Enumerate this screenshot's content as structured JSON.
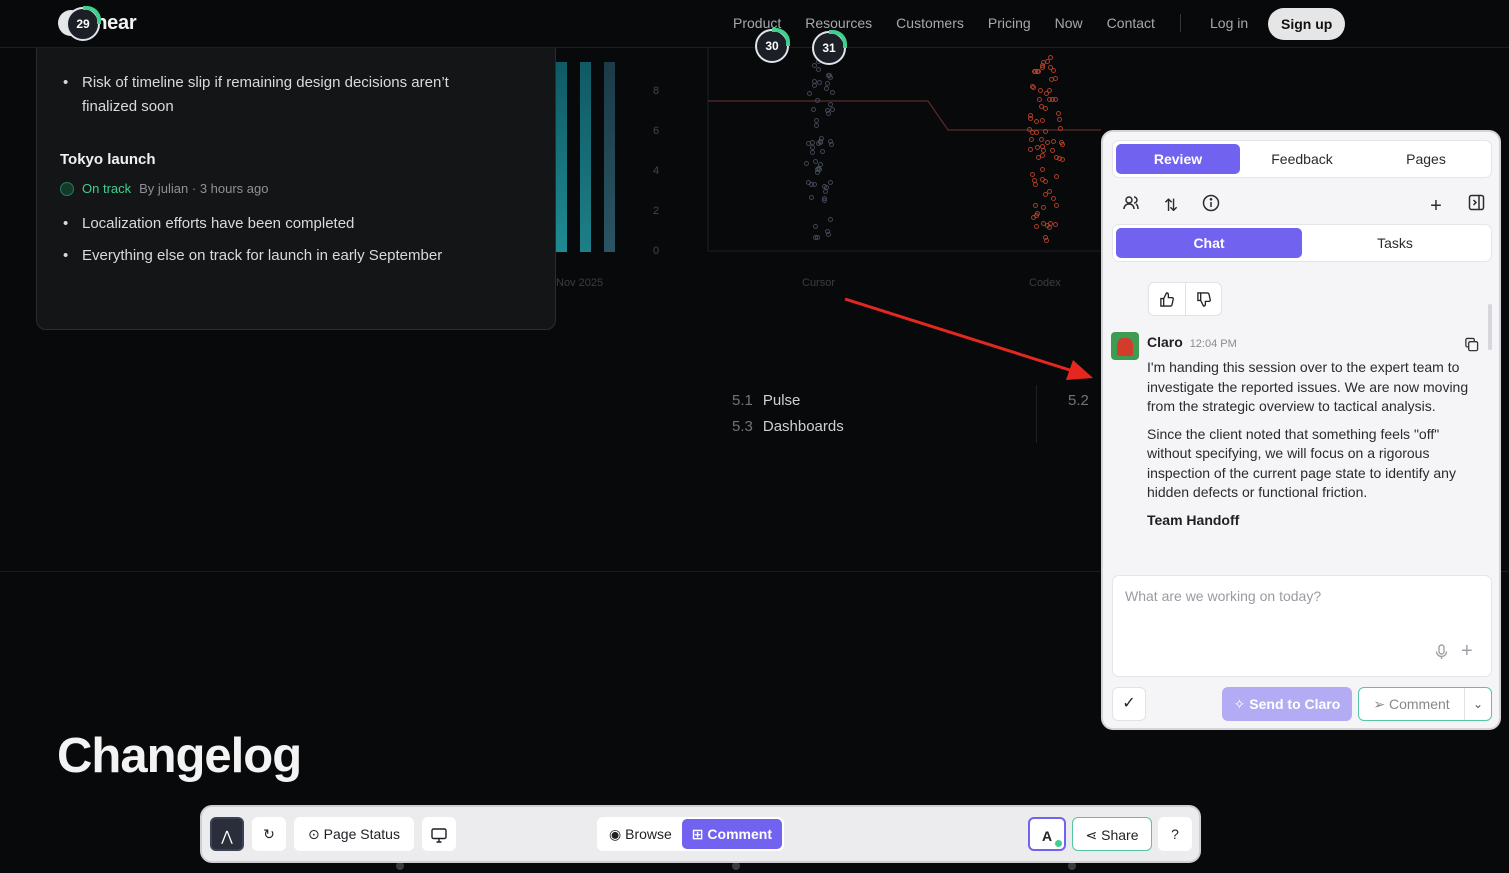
{
  "nav": {
    "logo_text": "inear",
    "links": [
      "Product",
      "Resources",
      "Customers",
      "Pricing",
      "Now",
      "Contact"
    ],
    "login": "Log in",
    "signup": "Sign up"
  },
  "markers": [
    "29",
    "30",
    "31"
  ],
  "update_card": {
    "risk_item": "Risk of timeline slip if remaining design decisions aren’t finalized soon",
    "project_title": "Tokyo launch",
    "status": "On track",
    "byline": "By julian · 3 hours ago",
    "items": [
      "Localization efforts have been completed",
      "Everything else on track for launch in early September"
    ]
  },
  "chart_data": {
    "type": "scatter",
    "y_ticks": [
      "8",
      "6",
      "4",
      "2",
      "0"
    ],
    "x_labels": [
      "Nov 2025",
      "Cursor",
      "Codex"
    ],
    "colors": {
      "teal_bar": "#1f8a93",
      "accent_red": "#c2452d",
      "gray_dot": "#4a5060"
    }
  },
  "section_nav": {
    "items": [
      {
        "num": "5.1",
        "label": "Pulse"
      },
      {
        "num": "5.3",
        "label": "Dashboards"
      }
    ],
    "right_num": "5.2"
  },
  "changelog_title": "Changelog",
  "panel": {
    "tabs": [
      "Review",
      "Feedback",
      "Pages"
    ],
    "subtabs": [
      "Chat",
      "Tasks"
    ],
    "message": {
      "author": "Claro",
      "time": "12:04 PM",
      "p1": "I'm handing this session over to the expert team to investigate the reported issues. We are now moving from the strategic overview to tactical analysis.",
      "p2": "Since the client noted that something feels \"off\" without specifying, we will focus on a rigorous inspection of the current page state to identify any hidden defects or functional friction.",
      "heading": "Team Handoff"
    },
    "composer_placeholder": "What are we working on today?",
    "send_label": "Send to Claro",
    "comment_label": "Comment"
  },
  "bottombar": {
    "page_status": "Page Status",
    "browse": "Browse",
    "comment": "Comment",
    "share": "Share"
  },
  "colors": {
    "accent": "#7162f0",
    "success": "#3ecf8e",
    "annotation_arrow": "#e5281f"
  }
}
